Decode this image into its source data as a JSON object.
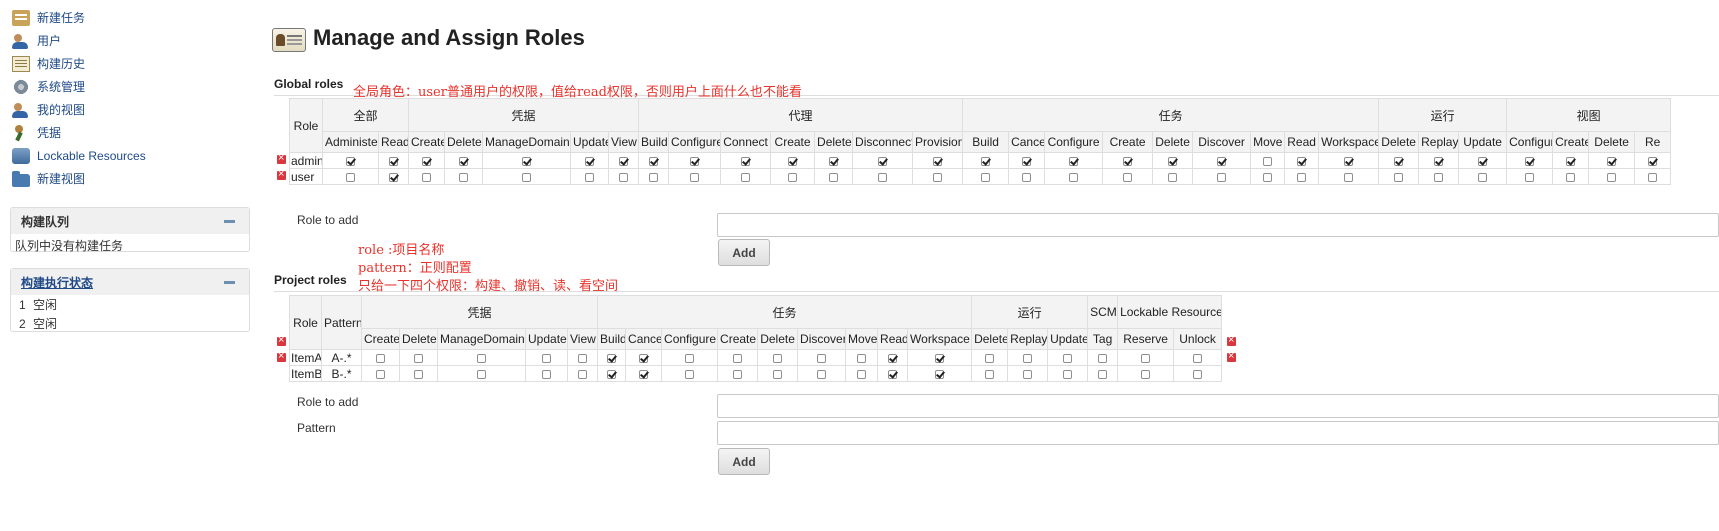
{
  "sidebar": {
    "tasks": [
      {
        "label": "新建任务",
        "icon": "new-item-icon"
      },
      {
        "label": "用户",
        "icon": "people-icon"
      },
      {
        "label": "构建历史",
        "icon": "build-history-icon"
      },
      {
        "label": "系统管理",
        "icon": "gear-icon"
      },
      {
        "label": "我的视图",
        "icon": "people-icon"
      },
      {
        "label": "凭据",
        "icon": "credentials-icon"
      },
      {
        "label": "Lockable Resources",
        "icon": "lock-icon"
      },
      {
        "label": "新建视图",
        "icon": "folder-icon"
      }
    ],
    "build_queue": {
      "title": "构建队列",
      "empty_text": "队列中没有构建任务"
    },
    "executor_status": {
      "title": "构建执行状态",
      "executors": [
        {
          "num": "1",
          "state": "空闲"
        },
        {
          "num": "2",
          "state": "空闲"
        }
      ]
    }
  },
  "page": {
    "title": "Manage and Assign Roles"
  },
  "global_roles": {
    "label": "Global roles",
    "role_header": "Role",
    "groups": [
      {
        "name": "全部",
        "perms": [
          "Administer",
          "Read"
        ]
      },
      {
        "name": "凭据",
        "perms": [
          "Create",
          "Delete",
          "ManageDomains",
          "Update",
          "View"
        ]
      },
      {
        "name": "代理",
        "perms": [
          "Build",
          "Configure",
          "Connect",
          "Create",
          "Delete",
          "Disconnect",
          "Provision"
        ]
      },
      {
        "name": "任务",
        "perms": [
          "Build",
          "Cancel",
          "Configure",
          "Create",
          "Delete",
          "Discover",
          "Move",
          "Read",
          "Workspace"
        ]
      },
      {
        "name": "运行",
        "perms": [
          "Delete",
          "Replay",
          "Update"
        ]
      },
      {
        "name": "视图",
        "perms": [
          "Configure",
          "Create",
          "Delete",
          "Re"
        ]
      }
    ],
    "rows": [
      {
        "role": "admin",
        "checks": [
          1,
          1,
          1,
          1,
          1,
          1,
          1,
          1,
          1,
          1,
          1,
          1,
          1,
          1,
          1,
          1,
          1,
          1,
          1,
          1,
          0,
          1,
          1,
          1,
          1,
          1,
          1,
          1,
          1,
          1
        ]
      },
      {
        "role": "user",
        "checks": [
          0,
          1,
          0,
          0,
          0,
          0,
          0,
          0,
          0,
          0,
          0,
          0,
          0,
          0,
          0,
          0,
          0,
          0,
          0,
          0,
          0,
          0,
          0,
          0,
          0,
          0,
          0,
          0,
          0,
          0
        ]
      }
    ],
    "role_to_add_label": "Role to add",
    "add_button": "Add"
  },
  "project_roles": {
    "label": "Project roles",
    "role_header": "Role",
    "pattern_header": "Pattern",
    "groups": [
      {
        "name": "凭据",
        "perms": [
          "Create",
          "Delete",
          "ManageDomains",
          "Update",
          "View"
        ]
      },
      {
        "name": "任务",
        "perms": [
          "Build",
          "Cancel",
          "Configure",
          "Create",
          "Delete",
          "Discover",
          "Move",
          "Read",
          "Workspace"
        ]
      },
      {
        "name": "运行",
        "perms": [
          "Delete",
          "Replay",
          "Update"
        ]
      },
      {
        "name": "SCM",
        "perms": [
          "Tag"
        ]
      },
      {
        "name": "Lockable Resources",
        "perms": [
          "Reserve",
          "Unlock"
        ]
      }
    ],
    "rows": [
      {
        "role": "ItemA",
        "pattern": "A-.*",
        "checks": [
          0,
          0,
          0,
          0,
          0,
          1,
          1,
          0,
          0,
          0,
          0,
          0,
          1,
          1,
          0,
          0,
          0,
          0,
          0,
          0
        ]
      },
      {
        "role": "ItemB",
        "pattern": "B-.*",
        "checks": [
          0,
          0,
          0,
          0,
          0,
          1,
          1,
          0,
          0,
          0,
          0,
          0,
          1,
          1,
          0,
          0,
          0,
          0,
          0,
          0
        ]
      }
    ],
    "role_to_add_label": "Role to add",
    "pattern_label": "Pattern",
    "add_button": "Add"
  },
  "annotations": {
    "global_note": "全局角色：user普通用户的权限，值给read权限，否则用户上面什么也不能看",
    "project_note_1": "role  :项目名称",
    "project_note_2": "pattern：正则配置",
    "project_note_3": "只给一下四个权限：构建、撤销、读、看空间"
  },
  "colors": {
    "link": "#204a87",
    "annotation": "#e8332c",
    "delete_icon": "#d9363e"
  }
}
